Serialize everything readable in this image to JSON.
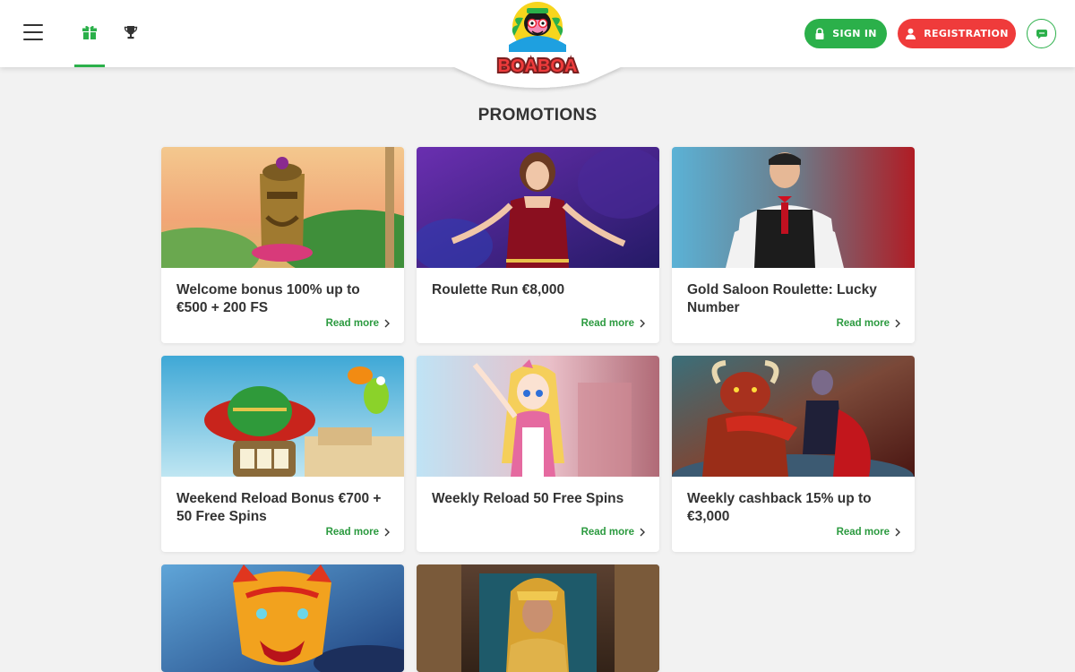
{
  "header": {
    "menu_icon": "hamburger-icon",
    "nav": [
      {
        "icon": "gift-icon",
        "active": true
      },
      {
        "icon": "trophy-icon",
        "active": false
      }
    ],
    "logo_text": "BOABOA",
    "sign_in_label": "SIGN IN",
    "sign_in_icon": "lock-icon",
    "register_label": "REGISTRATION",
    "register_icon": "user-icon",
    "chat_icon": "chat-icon",
    "colors": {
      "green": "#2bb04a",
      "red": "#ef3b3b"
    }
  },
  "page": {
    "title": "PROMOTIONS"
  },
  "promotions": [
    {
      "title": "Welcome bonus 100% up to €500 + 200 FS",
      "more": "Read more",
      "image": "tiki-totem-beach"
    },
    {
      "title": "Roulette Run €8,000",
      "more": "Read more",
      "image": "live-dealer-woman-red-dress"
    },
    {
      "title": "Gold Saloon Roulette: Lucky Number",
      "more": "Read more",
      "image": "live-dealer-man-vest"
    },
    {
      "title": "Weekend Reload Bonus €700 + 50 Free Spins",
      "more": "Read more",
      "image": "sombrero-slot-machine-parrot"
    },
    {
      "title": "Weekly Reload 50 Free Spins",
      "more": "Read more",
      "image": "anime-maid-girl"
    },
    {
      "title": "Weekly cashback 15% up to €3,000",
      "more": "Read more",
      "image": "bull-matador"
    },
    {
      "title": "",
      "more": "",
      "image": "tiger-mask"
    },
    {
      "title": "",
      "more": "",
      "image": "cleopatra"
    }
  ]
}
